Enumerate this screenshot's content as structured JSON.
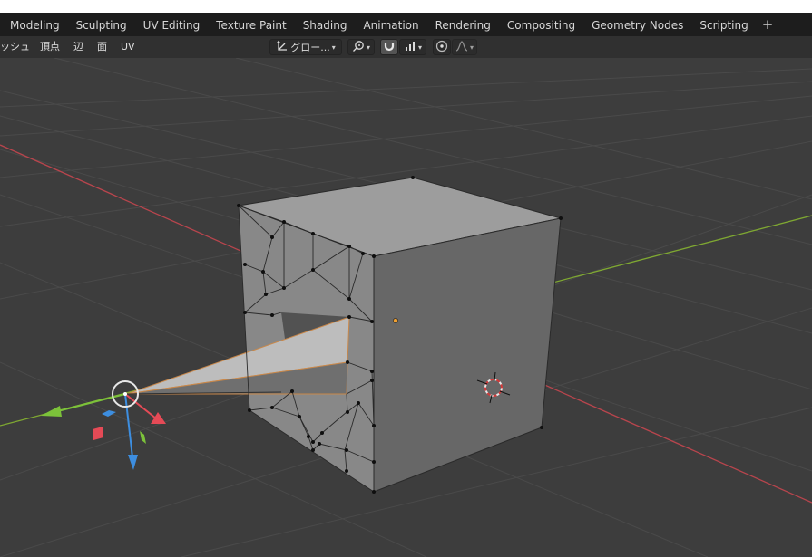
{
  "workspace_tabs": [
    "Modeling",
    "Sculpting",
    "UV Editing",
    "Texture Paint",
    "Shading",
    "Animation",
    "Rendering",
    "Compositing",
    "Geometry Nodes",
    "Scripting"
  ],
  "add_workspace_label": "+",
  "header_menu": {
    "mesh": "ッシュ",
    "vertex": "頂点",
    "edge": "辺",
    "face": "面",
    "uv": "UV"
  },
  "transform_orientation": {
    "value": "グロー...",
    "icon": "transform-orientation-icon"
  },
  "pivot_point": {
    "icon": "pivot-point-icon"
  },
  "snapping": {
    "icon": "magnet-icon",
    "active": true,
    "increment_icon": "snap-increment-icon"
  },
  "proportional_editing": {
    "icon": "proportional-editing-icon",
    "falloff_icon": "falloff-curve-icon"
  },
  "viewport": {
    "background_color": "#3d3d3d",
    "grid_color": "#4a4a4a",
    "x_axis_color": "#b8454d",
    "y_axis_color": "#7fa832",
    "mesh_face_light": "#9d9d9d",
    "mesh_face_dark": "#676767",
    "gizmo_x_color": "#e54a56",
    "gizmo_y_color": "#7cc23a",
    "gizmo_z_color": "#3d8ee0",
    "cursor_icon": "3d-cursor-icon",
    "origin_icon": "object-origin-icon"
  }
}
